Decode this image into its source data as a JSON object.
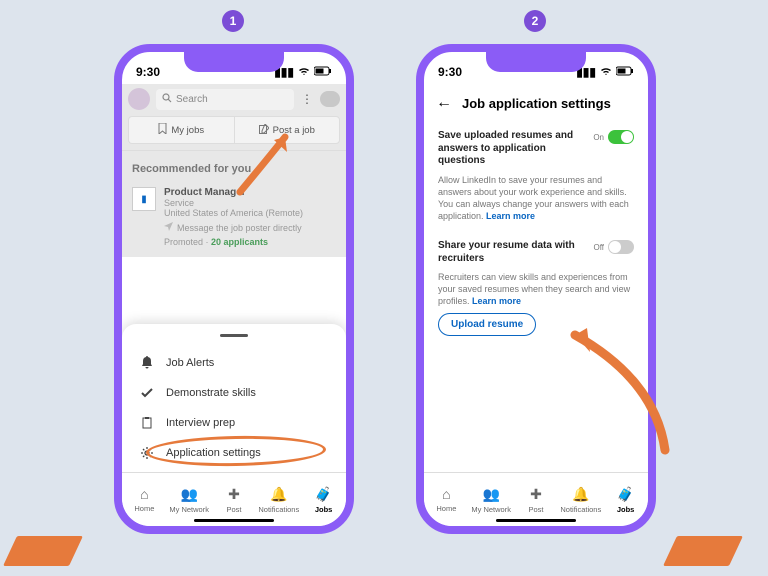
{
  "steps": {
    "one": "1",
    "two": "2"
  },
  "status": {
    "time": "9:30"
  },
  "phone1": {
    "search_placeholder": "Search",
    "myjobs": "My jobs",
    "postjob": "Post a job",
    "section": "Recommended for you",
    "job": {
      "title": "Product Manager",
      "company": "Service",
      "location": "United States of America (Remote)",
      "msg": "Message the job poster directly",
      "promoted": "Promoted · ",
      "applicants": "20 applicants"
    },
    "sheet": {
      "alerts": "Job Alerts",
      "demo": "Demonstrate skills",
      "prep": "Interview prep",
      "settings": "Application settings"
    }
  },
  "phone2": {
    "title": "Job application settings",
    "save": {
      "title": "Save uploaded resumes and answers to application questions",
      "state": "On",
      "desc": "Allow LinkedIn to save your resumes and answers about your work experience and skills. You can always change your answers with each application. ",
      "learn": "Learn more"
    },
    "share": {
      "title": "Share your resume data with recruiters",
      "state": "Off",
      "desc": "Recruiters can view skills and experiences from your saved resumes when they search and view profiles. ",
      "learn": "Learn more"
    },
    "upload": "Upload resume"
  },
  "nav": {
    "home": "Home",
    "network": "My Network",
    "post": "Post",
    "notifications": "Notifications",
    "jobs": "Jobs"
  }
}
